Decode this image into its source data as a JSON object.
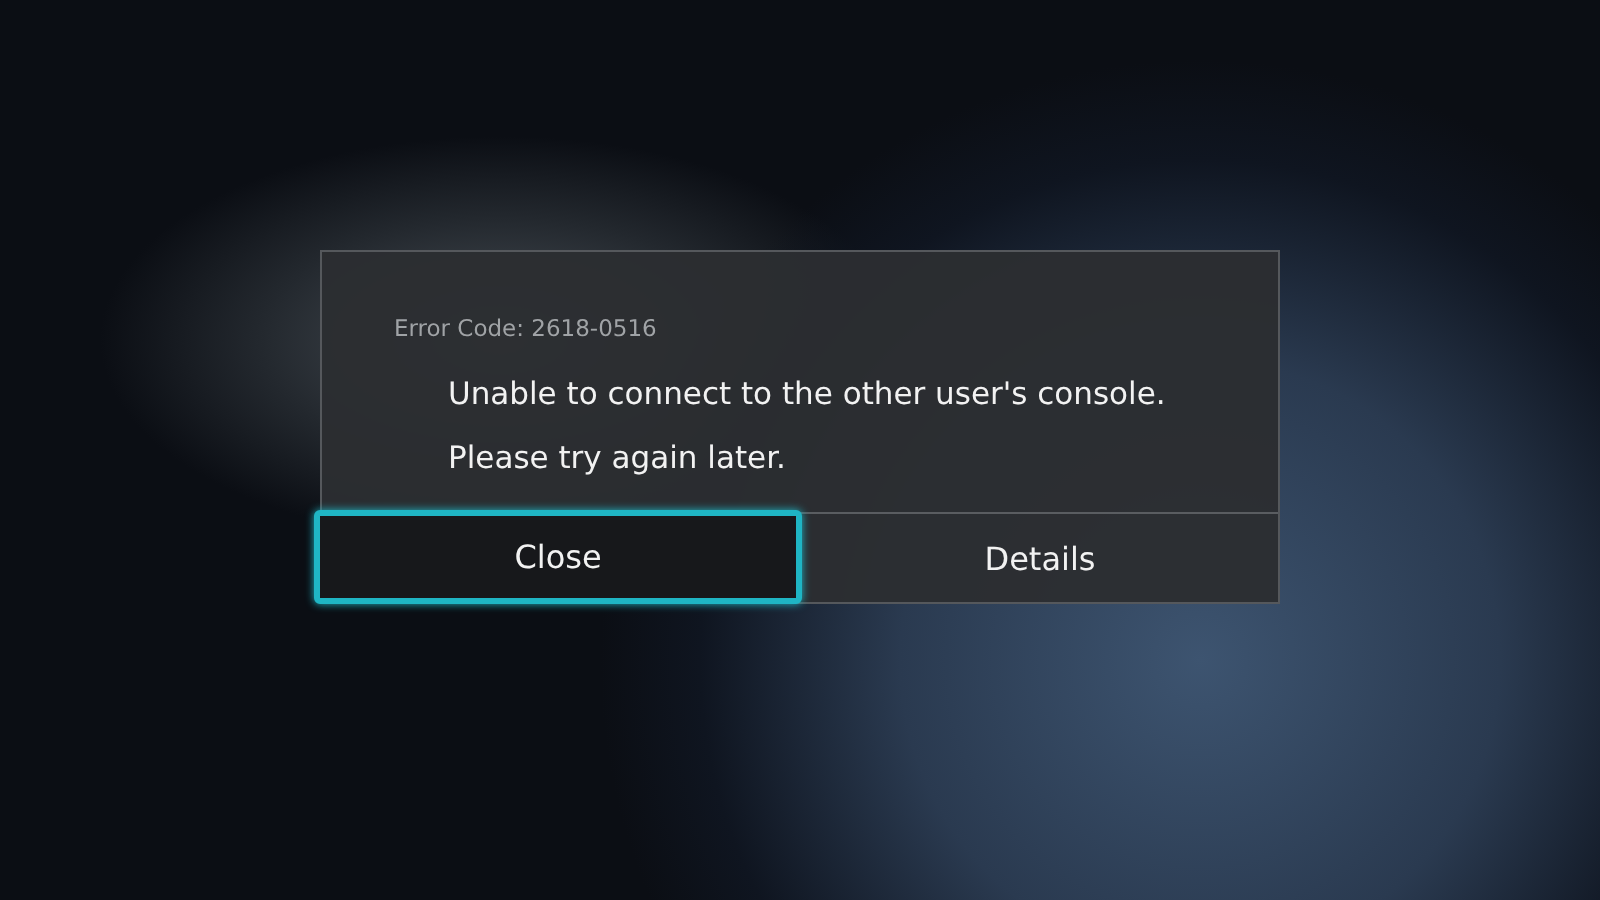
{
  "dialog": {
    "error_code": "Error Code: 2618-0516",
    "messages": [
      "Unable to connect to the other user's console.",
      "Please try again later."
    ],
    "buttons": [
      {
        "label": "Close",
        "selected": true
      },
      {
        "label": "Details",
        "selected": false
      }
    ]
  }
}
